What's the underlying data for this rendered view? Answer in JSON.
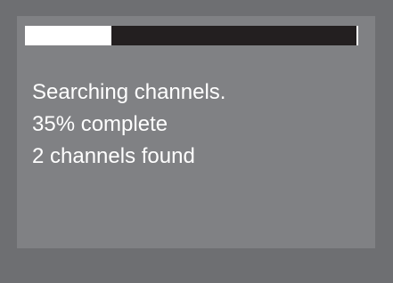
{
  "colors": {
    "bezel": "#6e6f72",
    "panel": "#808184",
    "progress_track": "#231f20",
    "progress_fill": "#ffffff",
    "text": "#ffffff"
  },
  "progress": {
    "fraction": 0.26
  },
  "status": {
    "searching": "Searching channels.",
    "percent": "35% complete",
    "found": "2 channels found"
  }
}
